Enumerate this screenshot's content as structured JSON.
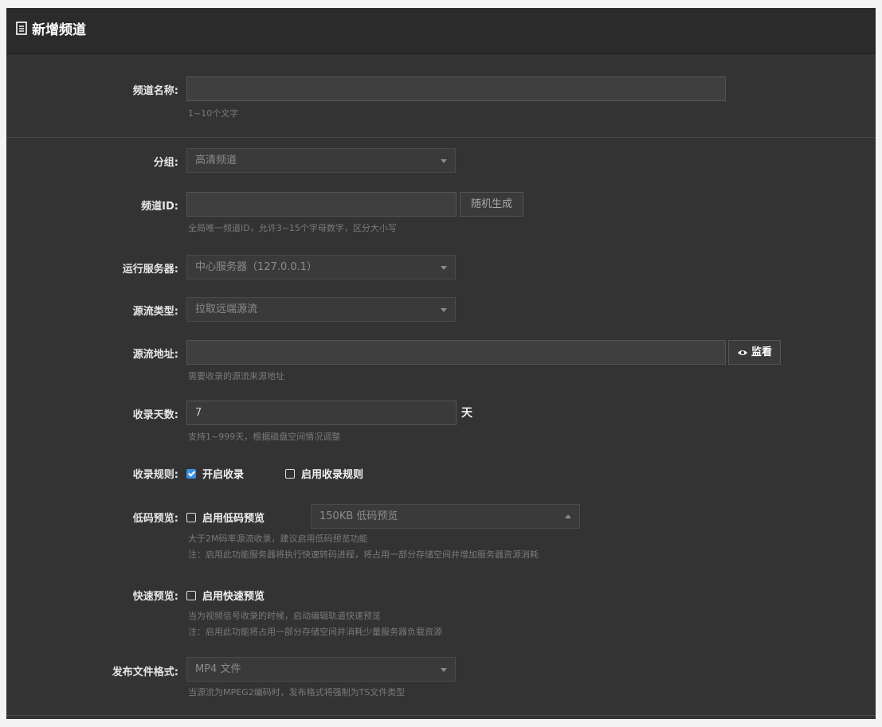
{
  "header": {
    "title": "新增频道",
    "icon": "document-icon"
  },
  "channel_name": {
    "label": "频道名称:",
    "value": "",
    "hint": "1~10个文字"
  },
  "group": {
    "label": "分组:",
    "selected": "高清频道"
  },
  "channel_id": {
    "label": "频道ID:",
    "value": "",
    "random_button": "随机生成",
    "hint": "全局唯一频道ID，允许3~15个字母数字，区分大小写"
  },
  "server": {
    "label": "运行服务器:",
    "selected": "中心服务器（127.0.0.1）"
  },
  "source_type": {
    "label": "源流类型:",
    "selected": "拉取远端源流"
  },
  "source_url": {
    "label": "源流地址:",
    "value": "",
    "watch_button": "监看",
    "hint": "需要收录的源流来源地址"
  },
  "record_days": {
    "label": "收录天数:",
    "value": "7",
    "unit": "天",
    "hint": "支持1~999天，根据磁盘空间情况调整"
  },
  "record_rules": {
    "label": "收录规则:",
    "enable_record": "开启收录",
    "enable_record_checked": true,
    "enable_rules": "启用收录规则",
    "enable_rules_checked": false
  },
  "low_preview": {
    "label": "低码预览:",
    "checkbox": "启用低码预览",
    "checked": false,
    "selected": "150KB 低码预览",
    "hint1": "大于2M码率源流收录，建议启用低码预览功能",
    "hint2": "注：启用此功能服务器将执行快速转码进程，将占用一部分存储空间并增加服务器资源消耗"
  },
  "fast_preview": {
    "label": "快速预览:",
    "checkbox": "启用快速预览",
    "checked": false,
    "hint1": "当为视频信号收录的时候，启动编辑轨道快速预览",
    "hint2": "注：启用此功能将占用一部分存储空间并消耗少量服务器负载资源"
  },
  "publish_format": {
    "label": "发布文件格式:",
    "selected": "MP4 文件",
    "hint": "当源流为MPEG2编码时，发布格式将强制为TS文件类型"
  },
  "colors": {
    "accent": "#3b8fe0",
    "panel": "#333333",
    "header": "#2b2b2b"
  }
}
